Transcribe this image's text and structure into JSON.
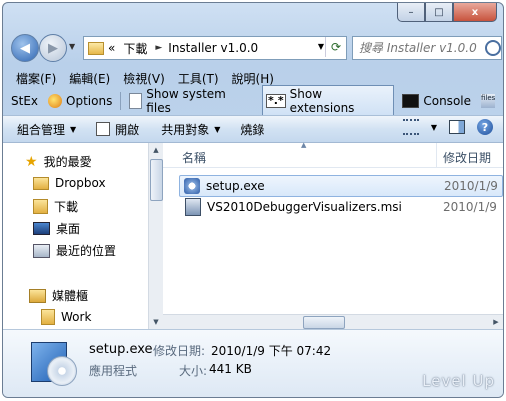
{
  "window": {
    "caption_buttons": {
      "minimize": "–",
      "maximize": "□",
      "close": "x"
    }
  },
  "address": {
    "chevron": "«",
    "path": [
      "下載",
      "Installer v1.0.0"
    ],
    "separator": "►"
  },
  "search": {
    "placeholder": "搜尋 Installer v1.0.0"
  },
  "menu": [
    "檔案(F)",
    "編輯(E)",
    "檢視(V)",
    "工具(T)",
    "說明(H)"
  ],
  "stex_toolbar": {
    "stex_label": "StEx",
    "options_label": "Options",
    "show_system_files": "Show system files",
    "show_extensions": "Show extensions",
    "console": "Console",
    "files_icon_text": "files"
  },
  "command_bar": {
    "organize": "組合管理",
    "open": "開啟",
    "share": "共用對象",
    "burn": "燒錄"
  },
  "nav_pane": {
    "favorites": "我的最愛",
    "items": [
      "Dropbox",
      "下載",
      "桌面",
      "最近的位置"
    ],
    "libraries": "媒體櫃",
    "library_items": [
      "Work"
    ]
  },
  "columns": {
    "name": "名稱",
    "date_modified": "修改日期"
  },
  "files": [
    {
      "name": "setup.exe",
      "date": "2010/1/9",
      "selected": true,
      "icon": "setup-exe-icon"
    },
    {
      "name": "VS2010DebuggerVisualizers.msi",
      "date": "2010/1/9",
      "selected": false,
      "icon": "msi-installer-icon"
    }
  ],
  "details": {
    "name": "setup.exe",
    "date_label": "修改日期:",
    "date_value": "2010/1/9 下午 07:42",
    "type": "應用程式",
    "size_label": "大小:",
    "size_value": "441 KB"
  },
  "watermark": "Level Up",
  "colors": {
    "accent": "#2f66b3",
    "selection": "#d8e8fa",
    "frame": "#b9d0ea"
  }
}
